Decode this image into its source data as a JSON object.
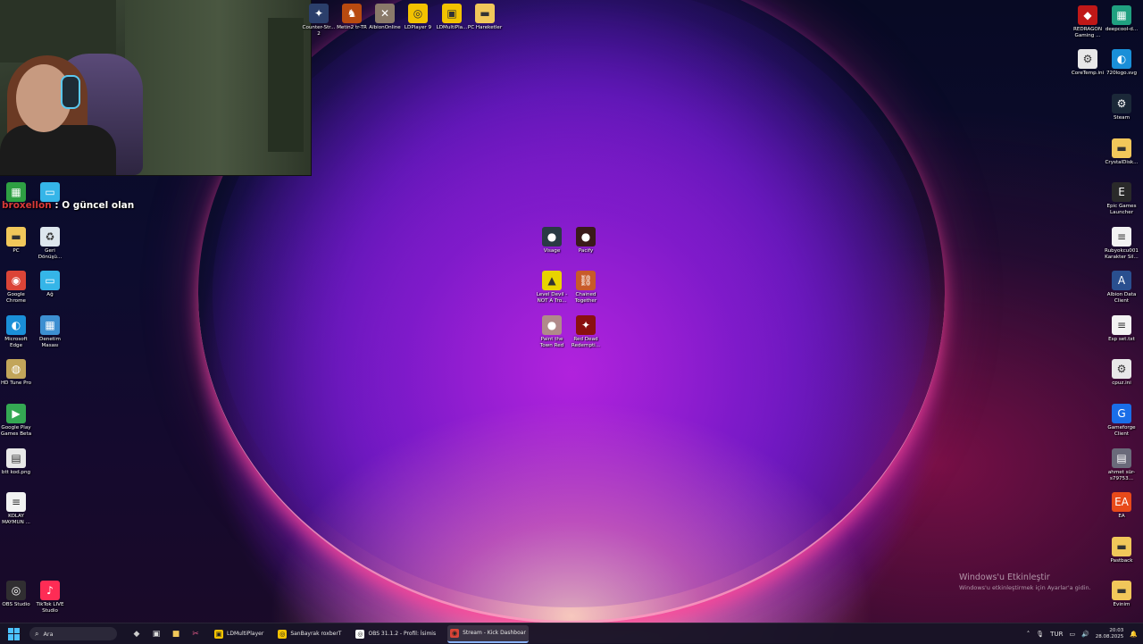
{
  "overlay": {
    "username": "broxellon",
    "message": "O güncel olan"
  },
  "top_icons": [
    {
      "label": "Counter-Str... 2",
      "icon": "counter-strike-icon",
      "color": "#2b3f6b"
    },
    {
      "label": "Metin2 tr-TR",
      "icon": "metin2-icon",
      "color": "#b84a10"
    },
    {
      "label": "AlbionOnline",
      "icon": "albion-online-icon",
      "color": "#8a7a6a"
    },
    {
      "label": "LDPlayer 9",
      "icon": "ldplayer-icon",
      "color": "#f2c200"
    },
    {
      "label": "LDMultiPla...",
      "icon": "ldmultiplayer-icon",
      "color": "#f2c200"
    },
    {
      "label": "PC Hareketler",
      "icon": "folder-icon",
      "color": "#f1c75a"
    }
  ],
  "left_icons": [
    {
      "label": "",
      "icon": "app-green-icon",
      "color": "#2ea043"
    },
    {
      "label": "",
      "icon": "monitor-icon",
      "color": "#35b5e8"
    },
    {
      "label": "PC",
      "icon": "folder-icon",
      "color": "#f1c75a"
    },
    {
      "label": "Geri Dönüşü...",
      "icon": "recycle-bin-icon",
      "color": "#dde6ee"
    },
    {
      "label": "Google Chrome",
      "icon": "chrome-icon",
      "color": "#db4437"
    },
    {
      "label": "Ağ",
      "icon": "network-icon",
      "color": "#35b5e8"
    },
    {
      "label": "Microsoft Edge",
      "icon": "edge-icon",
      "color": "#1a8fd8"
    },
    {
      "label": "Denetim Masası",
      "icon": "control-panel-icon",
      "color": "#3d8fd1"
    },
    {
      "label": "HD Tune Pro",
      "icon": "hdtune-icon",
      "color": "#c2a55a"
    },
    {
      "label": "Google Play Games Beta",
      "icon": "google-play-games-icon",
      "color": "#34a853"
    },
    {
      "label": "btt kod.png",
      "icon": "image-file-icon",
      "color": "#e8e8e8"
    },
    {
      "label": "KOLAY MAYMUN ...",
      "icon": "document-icon",
      "color": "#f2f2f2"
    },
    {
      "label": "OBS Studio",
      "icon": "obs-icon",
      "color": "#302e31"
    },
    {
      "label": "TikTok LIVE Studio",
      "icon": "tiktok-icon",
      "color": "#fe2c55"
    }
  ],
  "center_icons": [
    {
      "label": "Visage",
      "icon": "visage-icon",
      "color": "#2a3a44"
    },
    {
      "label": "Pacify",
      "icon": "pacify-icon",
      "color": "#3a1a1a"
    },
    {
      "label": "Level Devil - NOT A Tro...",
      "icon": "level-devil-icon",
      "color": "#e8d300"
    },
    {
      "label": "Chained Together",
      "icon": "chained-together-icon",
      "color": "#c85a2a"
    },
    {
      "label": "Paint the Town Red",
      "icon": "paint-the-town-red-icon",
      "color": "#b08a8a"
    },
    {
      "label": "Red Dead Redempti...",
      "icon": "red-dead-icon",
      "color": "#8a1010"
    }
  ],
  "right_icons": [
    {
      "label": "REDRAGON Gaming ...",
      "icon": "redragon-icon",
      "color": "#c01818"
    },
    {
      "label": "deepcool-d...",
      "icon": "deepcool-icon",
      "color": "#20a080"
    },
    {
      "label": "CoreTemp.ini",
      "icon": "settings-file-icon",
      "color": "#e8e8e8"
    },
    {
      "label": "720logo.svg",
      "icon": "edge-icon",
      "color": "#1a8fd8"
    },
    {
      "label": "Steam",
      "icon": "steam-icon",
      "color": "#1b2838"
    },
    {
      "label": "CrystalDisk...",
      "icon": "folder-icon",
      "color": "#f1c75a"
    },
    {
      "label": "Epic Games Launcher",
      "icon": "epic-games-icon",
      "color": "#2a2a2a"
    },
    {
      "label": "Rubyokcu001 Karakter Sil...",
      "icon": "document-icon",
      "color": "#f2f2f2"
    },
    {
      "label": "Albion Data Client",
      "icon": "albion-data-icon",
      "color": "#2a4f8f"
    },
    {
      "label": "Esp set.txt",
      "icon": "document-icon",
      "color": "#f2f2f2"
    },
    {
      "label": "cpuz.ini",
      "icon": "settings-file-icon",
      "color": "#e8e8e8"
    },
    {
      "label": "Gameforge Client",
      "icon": "gameforge-icon",
      "color": "#1a6ee8"
    },
    {
      "label": "ahmet sür-s79753...",
      "icon": "image-file-icon",
      "color": "#6a6a7a"
    },
    {
      "label": "EA",
      "icon": "ea-icon",
      "color": "#e84a1a"
    },
    {
      "label": "Pastback",
      "icon": "folder-icon",
      "color": "#f1c75a"
    },
    {
      "label": "Evinim",
      "icon": "folder-icon",
      "color": "#f1c75a"
    }
  ],
  "watermark": {
    "title": "Windows'u Etkinleştir",
    "subtitle": "Windows'u etkinleştirmek için Ayarlar'a gidin."
  },
  "taskbar": {
    "search_placeholder": "Ara",
    "apps": [
      {
        "label": "LDMultiPlayer",
        "icon": "ldmultiplayer-icon",
        "color": "#f2c200"
      },
      {
        "label": "SanBayrak roxberT",
        "icon": "ldplayer-icon",
        "color": "#f2c200"
      },
      {
        "label": "OBS 31.1.2 - Profil: İsimis",
        "icon": "obs-icon",
        "color": "#ffffff"
      },
      {
        "label": "Stream - Kick Dashboar",
        "icon": "chrome-icon",
        "color": "#db4437"
      }
    ],
    "tray": {
      "language": "TUR",
      "time": "20:03",
      "date": "28.08.2025"
    }
  }
}
